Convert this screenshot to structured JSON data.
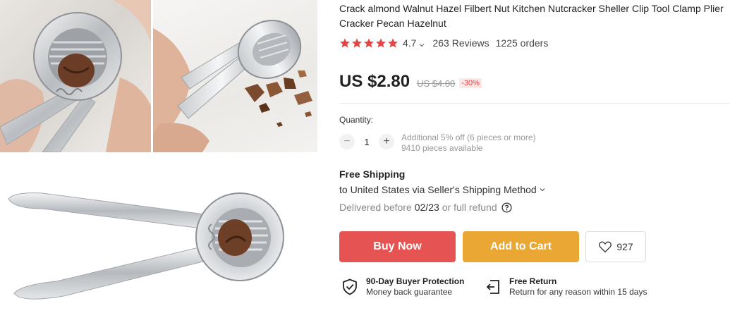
{
  "product": {
    "title": "Crack almond Walnut Hazel Filbert Nut Kitchen Nutcracker Sheller Clip Tool Clamp Plier Cracker Pecan Hazelnut",
    "images": [
      {
        "name": "nutcracker-in-hand-closeup"
      },
      {
        "name": "nutcracker-with-cracked-walnut"
      },
      {
        "name": "nutcracker-full-view"
      }
    ]
  },
  "rating": {
    "stars": 5,
    "value": "4.7",
    "reviews": "263 Reviews",
    "orders": "1225 orders",
    "star_color": "#e64545"
  },
  "price": {
    "current": "US $2.80",
    "original": "US $4.00",
    "discount": "-30%"
  },
  "quantity": {
    "label": "Quantity:",
    "value": "1",
    "minus": "−",
    "plus": "+",
    "note_discount": "Additional 5% off (6 pieces or more)",
    "note_available": "9410 pieces available"
  },
  "shipping": {
    "title": "Free Shipping",
    "method": "to United States via Seller's Shipping Method",
    "delivery_prefix": "Delivered before",
    "delivery_date": "02/23",
    "delivery_suffix": "or full refund"
  },
  "actions": {
    "buy_now": "Buy Now",
    "add_to_cart": "Add to Cart",
    "wishlist_count": "927",
    "buy_color": "#e65353",
    "cart_color": "#eba733"
  },
  "guarantees": {
    "protection_title": "90-Day Buyer Protection",
    "protection_sub": "Money back guarantee",
    "return_title": "Free Return",
    "return_sub": "Return for any reason within 15 days"
  }
}
